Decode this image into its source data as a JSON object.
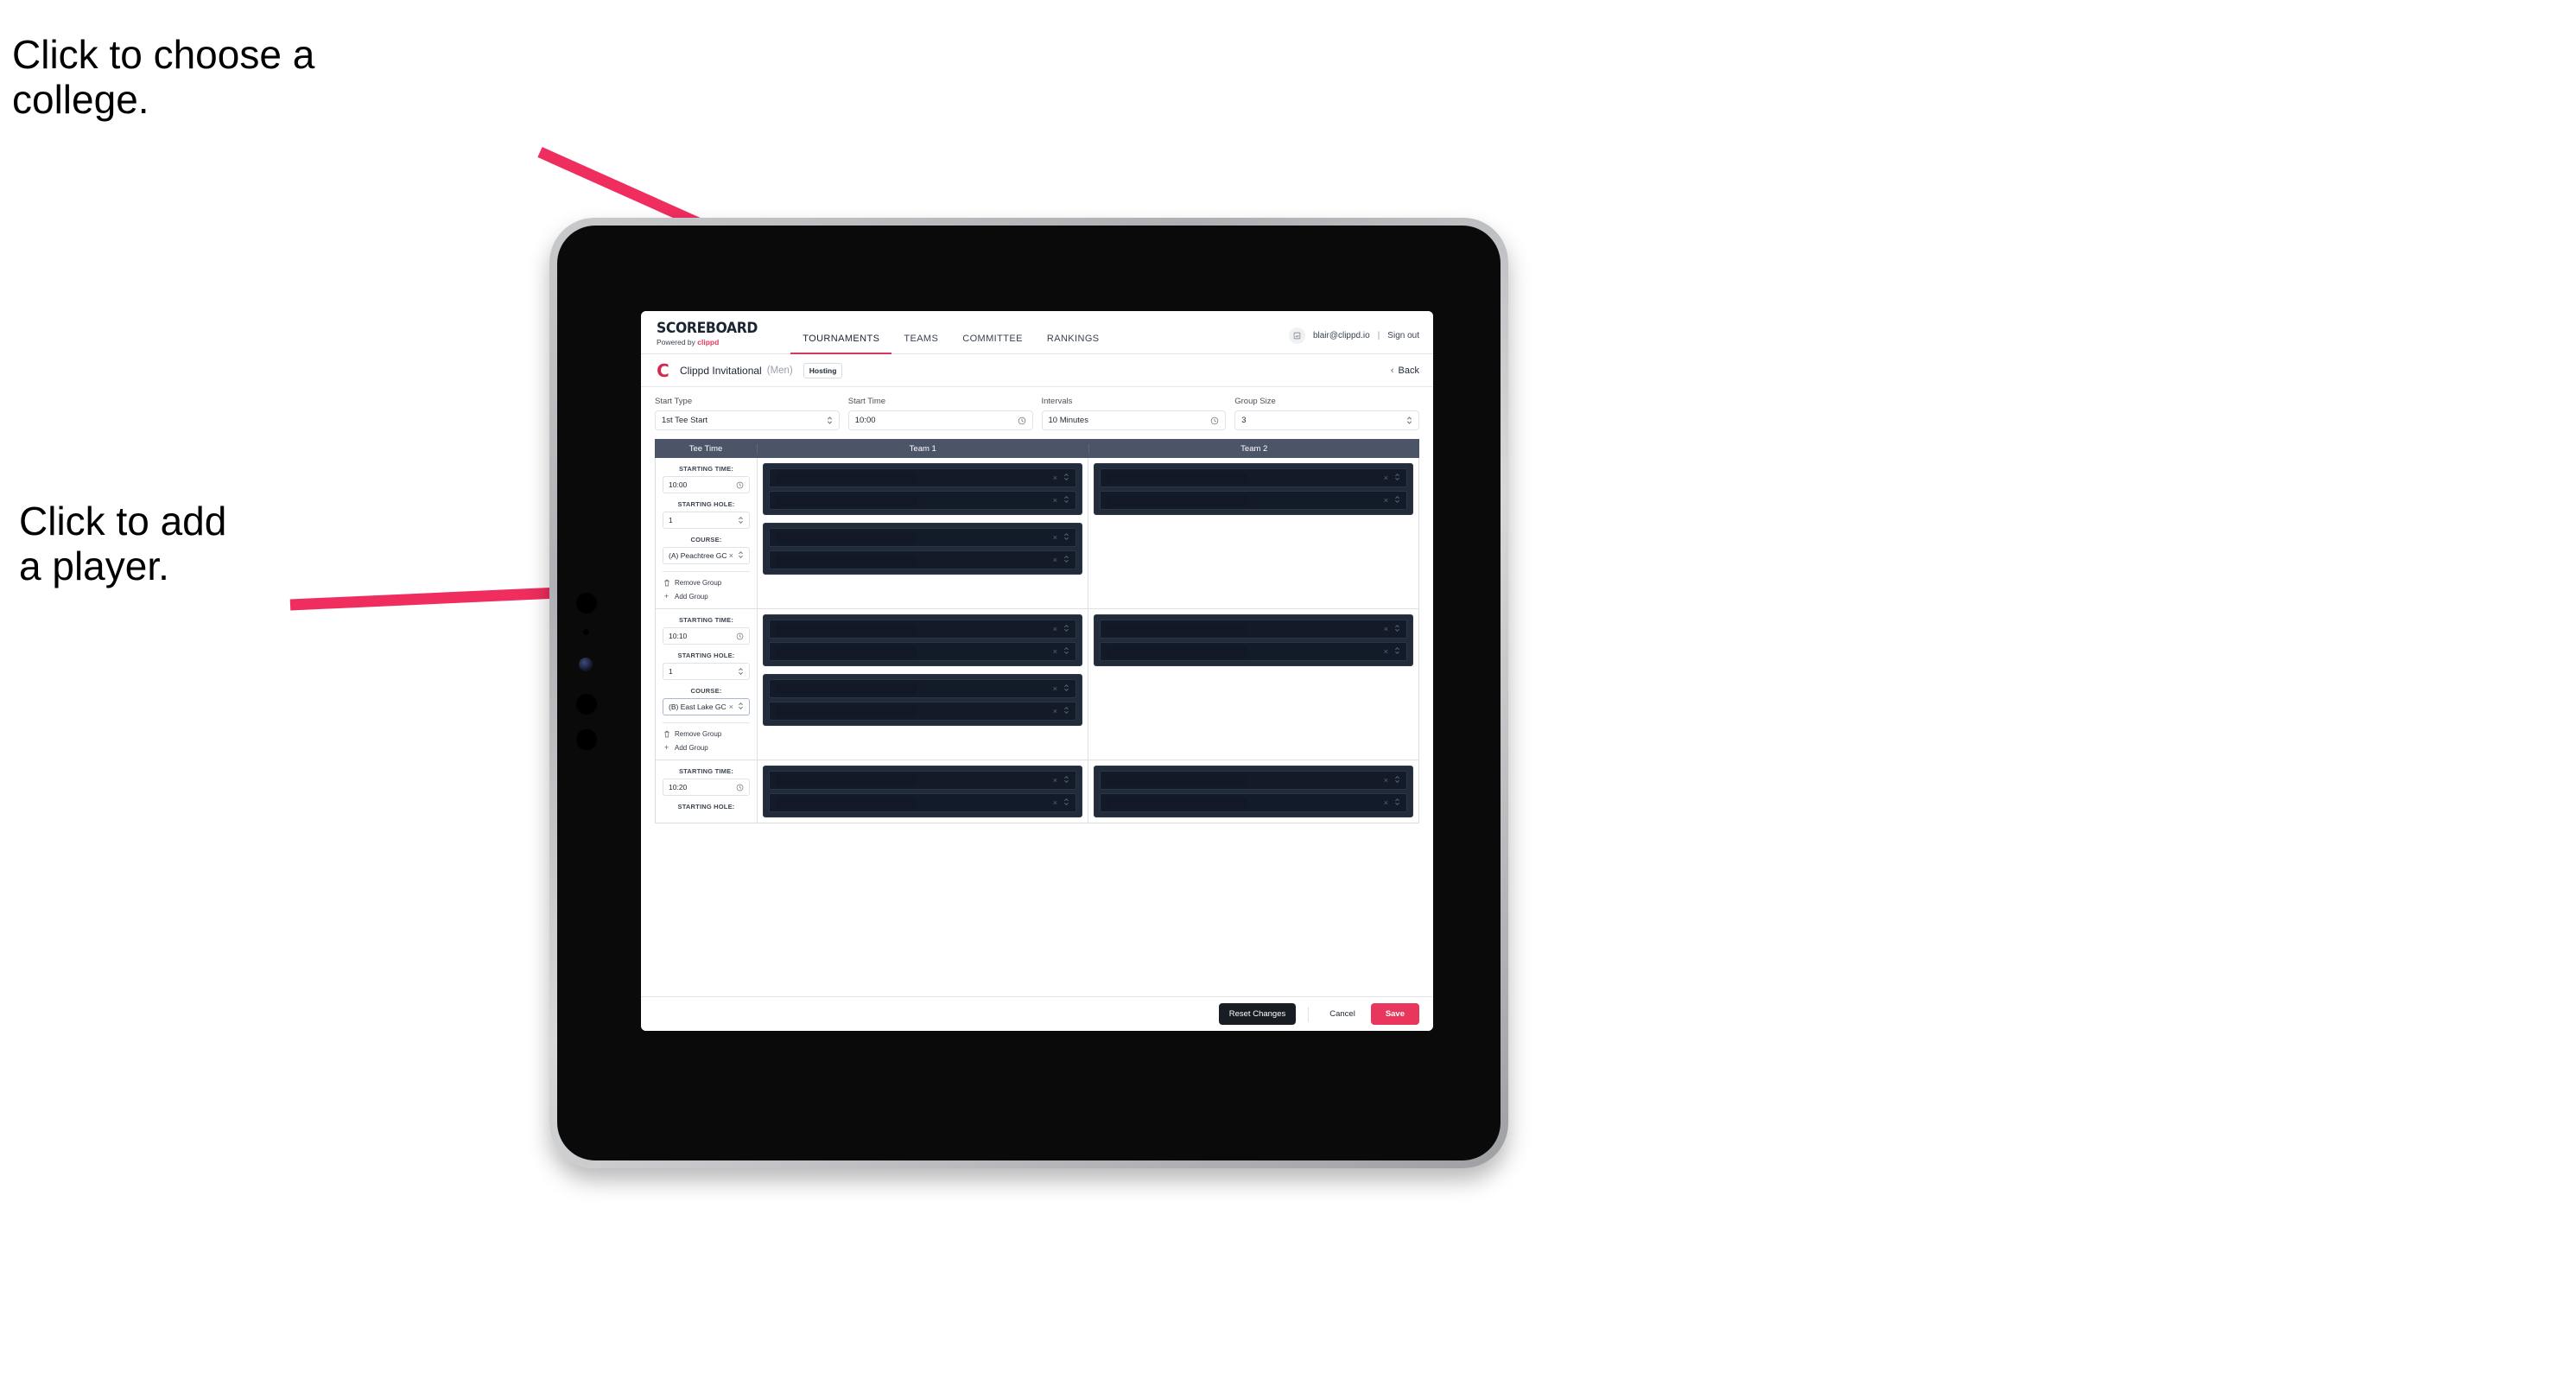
{
  "annotations": [
    {
      "id": "annot-college",
      "text": "Click to choose a\ncollege."
    },
    {
      "id": "annot-player",
      "text": "Click to add\na player."
    }
  ],
  "colors": {
    "accent_pink": "#e8365d",
    "arrow_pink": "#ef2d5e",
    "nav_underline": "#d43a5e",
    "table_header_bg": "#4c5568",
    "player_slot_bg": "#141b28",
    "group_block_bg": "#222b3a",
    "reset_button_bg": "#181c23"
  },
  "topbar": {
    "brand_main": "SCOREBOARD",
    "brand_sub_prefix": "Powered by ",
    "brand_sub_name": "clippd",
    "tabs": [
      {
        "label": "TOURNAMENTS",
        "active": true
      },
      {
        "label": "TEAMS",
        "active": false
      },
      {
        "label": "COMMITTEE",
        "active": false
      },
      {
        "label": "RANKINGS",
        "active": false
      }
    ],
    "avatar_icon": "user-avatar-icon",
    "email": "blair@clippd.io",
    "separator": "|",
    "sign_out": "Sign out"
  },
  "tournament_header": {
    "logo_letter": "C",
    "name": "Clippd Invitational",
    "gender": "(Men)",
    "badge": "Hosting",
    "back_label": "Back",
    "back_chevron": "‹"
  },
  "controls": [
    {
      "label": "Start Type",
      "value": "1st Tee Start",
      "icon": "stepper-icon"
    },
    {
      "label": "Start Time",
      "value": "10:00",
      "icon": "clock-icon"
    },
    {
      "label": "Intervals",
      "value": "10 Minutes",
      "icon": "clock-icon"
    },
    {
      "label": "Group Size",
      "value": "3",
      "icon": "stepper-icon"
    }
  ],
  "table": {
    "headers": [
      "Tee Time",
      "Team 1",
      "Team 2"
    ],
    "field_labels": {
      "starting_time": "STARTING TIME:",
      "starting_hole": "STARTING HOLE:",
      "course": "COURSE:"
    },
    "group_actions": {
      "remove": "Remove Group",
      "add": "Add Group",
      "remove_icon": "trash-icon",
      "add_icon": "plus-icon"
    },
    "slot_icons": {
      "clear": "×",
      "stepper": "stepper-icon"
    },
    "rows": [
      {
        "starting_time": "10:00",
        "starting_hole": "1",
        "course": "(A) Peachtree GC",
        "course_focused": false,
        "team1_groups": [
          {
            "slots": [
              "",
              ""
            ]
          },
          {
            "slots": [
              "",
              ""
            ]
          }
        ],
        "team2_groups": [
          {
            "slots": [
              "",
              ""
            ]
          }
        ]
      },
      {
        "starting_time": "10:10",
        "starting_hole": "1",
        "course": "(B) East Lake GC",
        "course_focused": true,
        "team1_groups": [
          {
            "slots": [
              "",
              ""
            ]
          },
          {
            "slots": [
              "",
              ""
            ]
          }
        ],
        "team2_groups": [
          {
            "slots": [
              "",
              ""
            ]
          }
        ]
      },
      {
        "starting_time": "10:20",
        "starting_hole": "",
        "course": "",
        "course_focused": false,
        "partial": true,
        "team1_groups": [
          {
            "slots": [
              "",
              ""
            ]
          }
        ],
        "team2_groups": [
          {
            "slots": [
              "",
              ""
            ]
          }
        ]
      }
    ]
  },
  "footer": {
    "reset": "Reset Changes",
    "cancel": "Cancel",
    "save": "Save"
  }
}
